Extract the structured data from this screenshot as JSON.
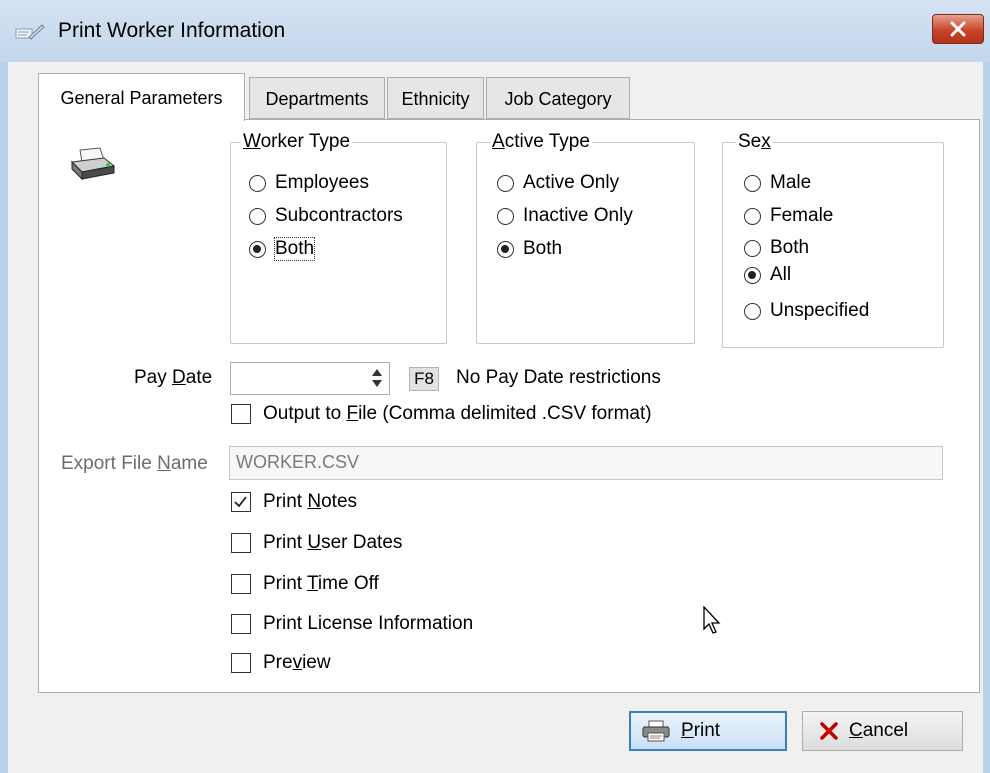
{
  "window": {
    "title": "Print Worker Information"
  },
  "tabs": [
    {
      "label": "General Parameters"
    },
    {
      "label": "Departments"
    },
    {
      "label": "Ethnicity"
    },
    {
      "label": "Job Category"
    }
  ],
  "worker_type": {
    "label_u": "W",
    "label_rest": "orker Type",
    "options": [
      "Employees",
      "Subcontractors",
      "Both"
    ],
    "selected": "Both"
  },
  "active_type": {
    "label_u": "A",
    "label_rest": "ctive Type",
    "options": [
      "Active Only",
      "Inactive Only",
      "Both"
    ],
    "selected": "Both"
  },
  "sex": {
    "label_pre": "Se",
    "label_u": "x",
    "options": [
      "Male",
      "Female",
      "Both",
      "All",
      "Unspecified"
    ],
    "selected": "All"
  },
  "pay_date": {
    "label_pre": "Pay ",
    "label_u": "D",
    "label_rest": "ate",
    "value": "",
    "f8_label": "F8",
    "note": "No Pay Date restrictions"
  },
  "output_to_file": {
    "label_pre": "Output to ",
    "label_u": "F",
    "label_rest": "ile (Comma delimited .CSV format)",
    "checked": false
  },
  "export_file_name": {
    "label_pre": "Export File ",
    "label_u": "N",
    "label_rest": "ame",
    "value": "WORKER.CSV"
  },
  "options": {
    "print_notes": {
      "pre": "Print ",
      "u": "N",
      "rest": "otes",
      "checked": true
    },
    "print_user_dates": {
      "pre": "Print ",
      "u": "U",
      "rest": "ser Dates",
      "checked": false
    },
    "print_time_off": {
      "pre": "Print ",
      "u": "T",
      "rest": "ime Off",
      "checked": false
    },
    "print_license": {
      "pre": "Print License Information",
      "u": "",
      "rest": "",
      "checked": false
    },
    "preview": {
      "pre": "Pre",
      "u": "v",
      "rest": "iew",
      "checked": false
    }
  },
  "buttons": {
    "print": {
      "u": "P",
      "rest": "rint"
    },
    "cancel": {
      "u": "C",
      "rest": "ancel"
    }
  },
  "colors": {
    "accent": "#3c7fb1",
    "close": "#c7452b",
    "cancel_icon": "#c00000"
  }
}
